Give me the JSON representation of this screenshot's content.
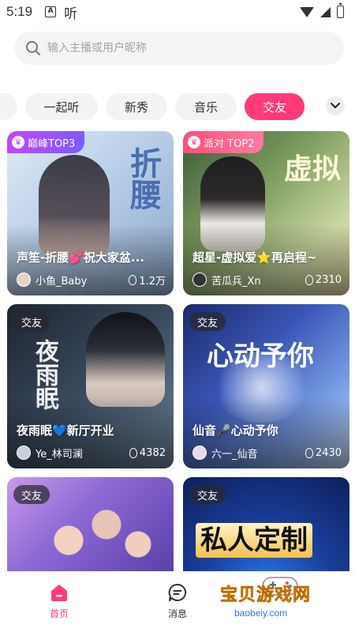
{
  "status_bar": {
    "time": "5:19",
    "app_glyph": "A",
    "app_text": "听"
  },
  "search": {
    "placeholder": "输入主播或用户昵称"
  },
  "tabs": [
    {
      "label": ""
    },
    {
      "label": "一起听"
    },
    {
      "label": "新秀"
    },
    {
      "label": "音乐"
    },
    {
      "label": "交友",
      "active": true
    }
  ],
  "cards": [
    {
      "badge": "巅峰TOP3",
      "title": "声笙-折腰💕祝大家盆...",
      "host": "小鱼_Baby",
      "heat": "1.2万",
      "deco": "折腰"
    },
    {
      "badge": "派对 TOP2",
      "title": "超星-虚拟爱⭐再启程~",
      "host": "苦瓜兵_Xn",
      "heat": "2310",
      "deco": "虚拟"
    },
    {
      "badge": "交友",
      "title": "夜雨眠💙新厅开业",
      "host": "Ye_林司澜",
      "heat": "4382",
      "deco": "夜雨眠"
    },
    {
      "badge": "交友",
      "title": "仙音🎤心动予你",
      "host": "六一_仙音",
      "heat": "2430",
      "deco": "心动予你"
    },
    {
      "badge": "交友"
    },
    {
      "badge": "交友",
      "deco": "私人定制"
    }
  ],
  "bottom_nav": [
    {
      "label": "首页",
      "icon": "home-icon",
      "active": true
    },
    {
      "label": "消息",
      "icon": "message-icon"
    }
  ],
  "watermark": {
    "title": "宝贝游戏网",
    "url": "baobeiy.com"
  },
  "colors": {
    "accent": "#ff3b7a",
    "search_bg": "#f4f4f6"
  }
}
